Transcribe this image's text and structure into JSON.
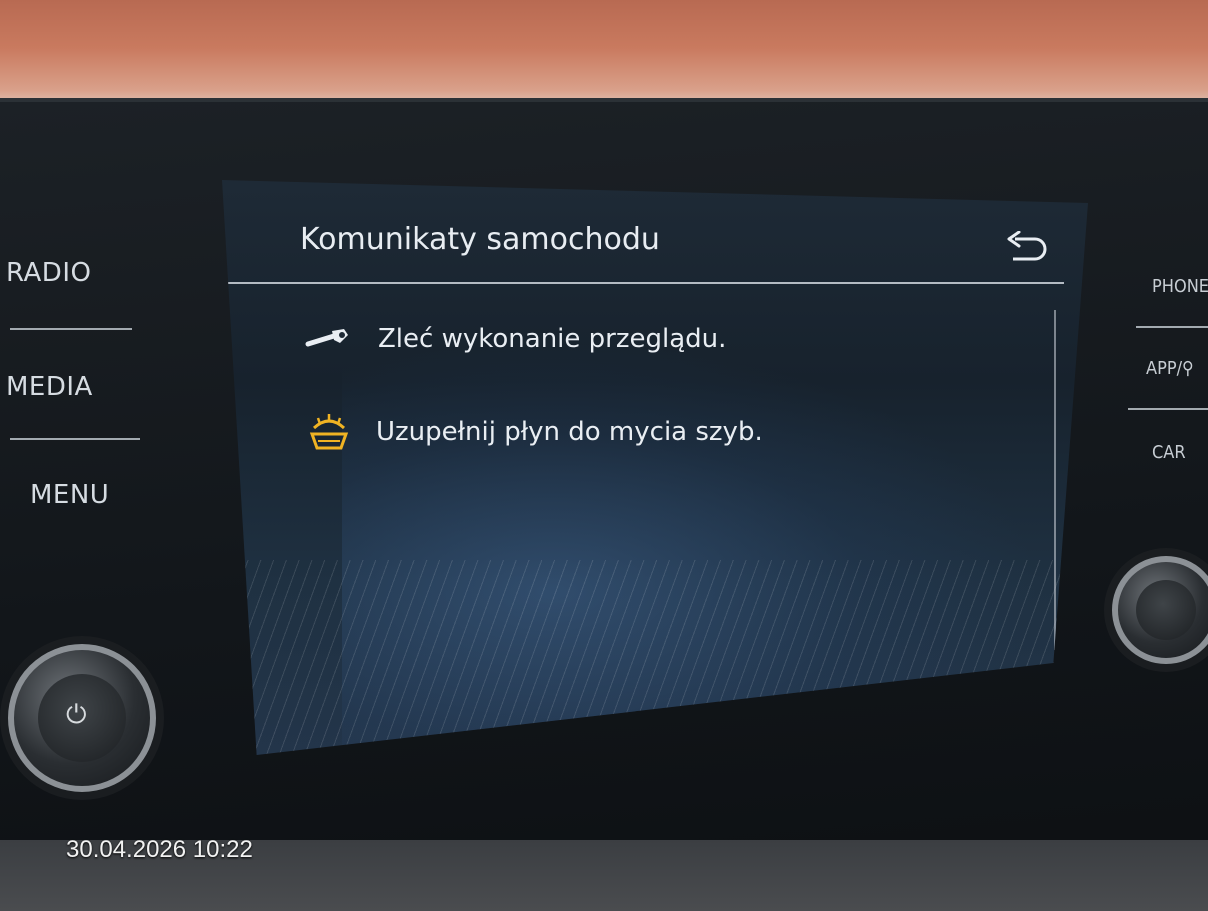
{
  "photo": {
    "timestamp": "30.04.2026 10:22"
  },
  "left_menu": [
    {
      "label": "RADIO"
    },
    {
      "label": "MEDIA"
    },
    {
      "label": "MENU"
    }
  ],
  "right_menu": [
    {
      "label": "PHONE"
    },
    {
      "label": "APP/⚲"
    },
    {
      "label": "CAR"
    }
  ],
  "screen": {
    "title": "Komunikaty samochodu",
    "back_icon": "back-arrow-icon",
    "messages": [
      {
        "icon": "wrench-icon",
        "icon_color": "#e9eef3",
        "text": "Zleć wykonanie przeglądu."
      },
      {
        "icon": "washer-fluid-icon",
        "icon_color": "#f0b323",
        "text": "Uzupełnij płyn do mycia szyb."
      }
    ]
  },
  "colors": {
    "warning_icon": "#f0b323",
    "text": "#e9eef3"
  }
}
